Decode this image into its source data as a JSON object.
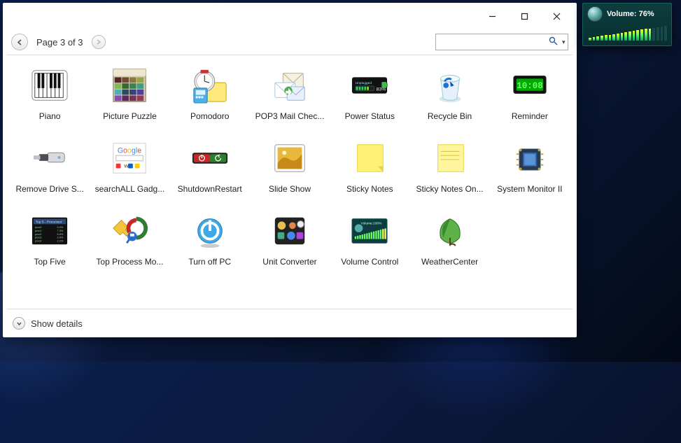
{
  "window": {
    "page_text": "Page 3 of 3",
    "search_placeholder": "",
    "footer_text": "Show details"
  },
  "win_buttons": {
    "min": "minimize",
    "max": "maximize",
    "close": "close"
  },
  "gadgets": [
    {
      "id": "piano",
      "label": "Piano"
    },
    {
      "id": "picture-puzzle",
      "label": "Picture Puzzle"
    },
    {
      "id": "pomodoro",
      "label": "Pomodoro"
    },
    {
      "id": "pop3-mail",
      "label": "POP3 Mail Chec..."
    },
    {
      "id": "power-status",
      "label": "Power Status"
    },
    {
      "id": "recycle-bin",
      "label": "Recycle Bin"
    },
    {
      "id": "reminder",
      "label": "Reminder",
      "display": "10:08"
    },
    {
      "id": "remove-drive",
      "label": "Remove Drive S..."
    },
    {
      "id": "searchall",
      "label": "searchALL Gadg...",
      "brand": "Google"
    },
    {
      "id": "shutdown-restart",
      "label": "ShutdownRestart"
    },
    {
      "id": "slide-show",
      "label": "Slide Show"
    },
    {
      "id": "sticky-notes",
      "label": "Sticky Notes"
    },
    {
      "id": "sticky-notes-on",
      "label": "Sticky Notes On..."
    },
    {
      "id": "system-monitor",
      "label": "System Monitor II"
    },
    {
      "id": "top-five",
      "label": "Top Five",
      "inner_title": "Top 5 - Processor"
    },
    {
      "id": "top-process",
      "label": "Top Process Mo..."
    },
    {
      "id": "turn-off-pc",
      "label": "Turn off PC"
    },
    {
      "id": "unit-converter",
      "label": "Unit Converter"
    },
    {
      "id": "volume-control",
      "label": "Volume Control",
      "inner_text": "Volume:100%"
    },
    {
      "id": "weather-center",
      "label": "WeatherCenter"
    }
  ],
  "volume_gadget": {
    "label": "Volume: 76%",
    "percent": 76,
    "bars_total": 20,
    "bars_lit": 16
  }
}
